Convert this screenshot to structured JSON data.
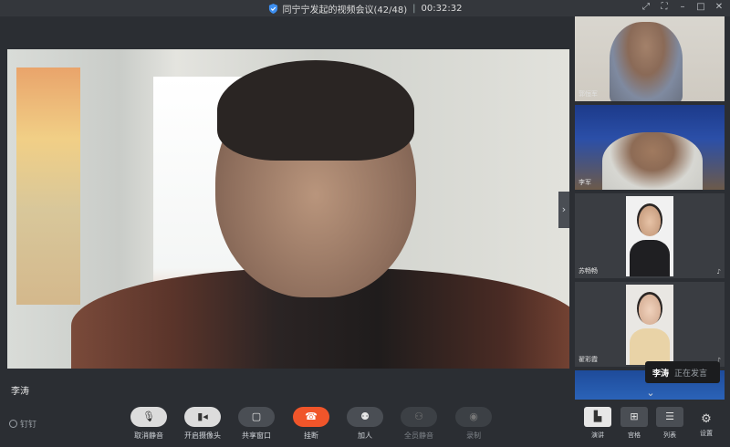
{
  "title_bar": {
    "meeting_title": "同宁宁发起的视频会议(42/48)",
    "separator": "|",
    "timer": "00:32:32"
  },
  "main_video": {
    "speaker_name": "李涛"
  },
  "participants": [
    {
      "name": "郭恒军"
    },
    {
      "name": "李军"
    },
    {
      "name": "苏畅畅"
    },
    {
      "name": "翟彩霞"
    }
  ],
  "speaking_tooltip": {
    "name": "李涛",
    "status": "正在发言"
  },
  "toolbar": {
    "brand": "钉钉",
    "buttons": [
      {
        "label": "取消静音",
        "icon": "mic-off-icon"
      },
      {
        "label": "开启摄像头",
        "icon": "camera-off-icon"
      },
      {
        "label": "共享窗口",
        "icon": "share-icon"
      },
      {
        "label": "挂断",
        "icon": "hangup-icon"
      },
      {
        "label": "加人",
        "icon": "add-person-icon"
      },
      {
        "label": "全员静音",
        "icon": "mute-all-icon"
      },
      {
        "label": "录制",
        "icon": "record-icon"
      }
    ],
    "view_buttons": [
      {
        "label": "演讲",
        "icon": "speaker-view-icon"
      },
      {
        "label": "宫格",
        "icon": "grid-view-icon"
      },
      {
        "label": "列表",
        "icon": "list-view-icon"
      }
    ],
    "settings_label": "设置"
  },
  "colors": {
    "hangup": "#f0552a",
    "background": "#2b2e33"
  }
}
